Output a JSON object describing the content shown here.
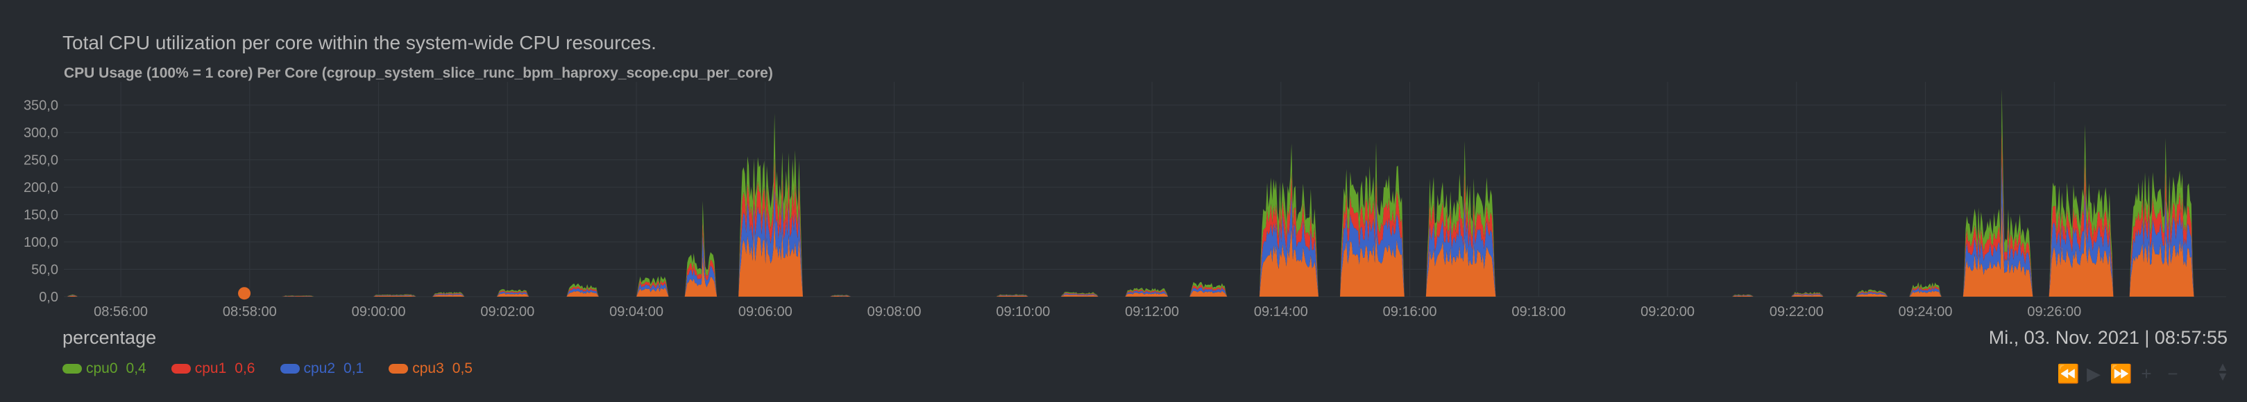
{
  "description": "Total CPU utilization per core within the system-wide CPU resources.",
  "chart_title": "CPU Usage (100% = 1 core) Per Core (cgroup_system_slice_runc_bpm_haproxy_scope.cpu_per_core)",
  "units": "percentage",
  "timestamp": "Mi., 03. Nov. 2021 | 08:57:55",
  "colors": {
    "background": "#272b30",
    "grid": "#33383e",
    "cpu0": "#63a22b",
    "cpu1": "#e0382d",
    "cpu2": "#3b64c7",
    "cpu3": "#e46a26"
  },
  "legend": [
    {
      "name": "cpu0",
      "value": "0,4",
      "color": "#63a22b"
    },
    {
      "name": "cpu1",
      "value": "0,6",
      "color": "#e0382d"
    },
    {
      "name": "cpu2",
      "value": "0,1",
      "color": "#3b64c7"
    },
    {
      "name": "cpu3",
      "value": "0,5",
      "color": "#e46a26"
    }
  ],
  "nav_controls": [
    "rewind-icon",
    "play-icon",
    "fast-forward-icon",
    "zoom-in-icon",
    "zoom-out-icon"
  ],
  "chart_data": {
    "type": "area",
    "stacked": true,
    "ylim": [
      0,
      380
    ],
    "yticks": [
      0,
      50,
      100,
      150,
      200,
      250,
      300,
      350
    ],
    "ytick_labels": [
      "0,0",
      "50,0",
      "100,0",
      "150,0",
      "200,0",
      "250,0",
      "300,0",
      "350,0"
    ],
    "x_range": [
      "08:55:07",
      "09:28:40"
    ],
    "xticks": [
      "08:56:00",
      "08:58:00",
      "09:00:00",
      "09:02:00",
      "09:04:00",
      "09:06:00",
      "09:08:00",
      "09:10:00",
      "09:12:00",
      "09:14:00",
      "09:16:00",
      "09:18:00",
      "09:20:00",
      "09:22:00",
      "09:24:00",
      "09:26:00"
    ],
    "grid": true,
    "highlight_point": {
      "x": "08:57:55",
      "y": 1
    },
    "series_names": [
      "cpu3",
      "cpu2",
      "cpu1",
      "cpu0"
    ],
    "bursts": [
      {
        "start": "08:55:10",
        "end": "08:55:20",
        "total": 4
      },
      {
        "start": "08:58:30",
        "end": "08:59:00",
        "total": 2
      },
      {
        "start": "08:59:55",
        "end": "09:00:35",
        "total": 4
      },
      {
        "start": "09:00:50",
        "end": "09:01:20",
        "total": 8
      },
      {
        "start": "09:01:50",
        "end": "09:02:20",
        "total": 13
      },
      {
        "start": "09:02:55",
        "end": "09:03:25",
        "total": 22
      },
      {
        "start": "09:04:00",
        "end": "09:04:30",
        "total": 35
      },
      {
        "start": "09:04:45",
        "end": "09:05:15",
        "total": 75,
        "peak": 175
      },
      {
        "start": "09:05:35",
        "end": "09:06:35",
        "total": 245,
        "peak": 335
      },
      {
        "start": "09:07:00",
        "end": "09:07:20",
        "total": 3
      },
      {
        "start": "09:09:35",
        "end": "09:10:05",
        "total": 4
      },
      {
        "start": "09:10:35",
        "end": "09:11:10",
        "total": 8
      },
      {
        "start": "09:11:35",
        "end": "09:12:15",
        "total": 15
      },
      {
        "start": "09:12:35",
        "end": "09:13:10",
        "total": 25
      },
      {
        "start": "09:13:40",
        "end": "09:14:35",
        "total": 200,
        "peak": 280
      },
      {
        "start": "09:14:55",
        "end": "09:15:55",
        "total": 220,
        "peak": 282
      },
      {
        "start": "09:16:15",
        "end": "09:17:20",
        "total": 205,
        "peak": 285
      },
      {
        "start": "09:21:00",
        "end": "09:21:20",
        "total": 4
      },
      {
        "start": "09:21:55",
        "end": "09:22:25",
        "total": 8
      },
      {
        "start": "09:22:55",
        "end": "09:23:25",
        "total": 12
      },
      {
        "start": "09:23:45",
        "end": "09:24:15",
        "total": 25
      },
      {
        "start": "09:24:35",
        "end": "09:25:40",
        "total": 150,
        "peak": 380
      },
      {
        "start": "09:25:55",
        "end": "09:26:55",
        "total": 190,
        "peak": 315
      },
      {
        "start": "09:27:10",
        "end": "09:28:10",
        "total": 210,
        "peak": 290
      }
    ]
  }
}
